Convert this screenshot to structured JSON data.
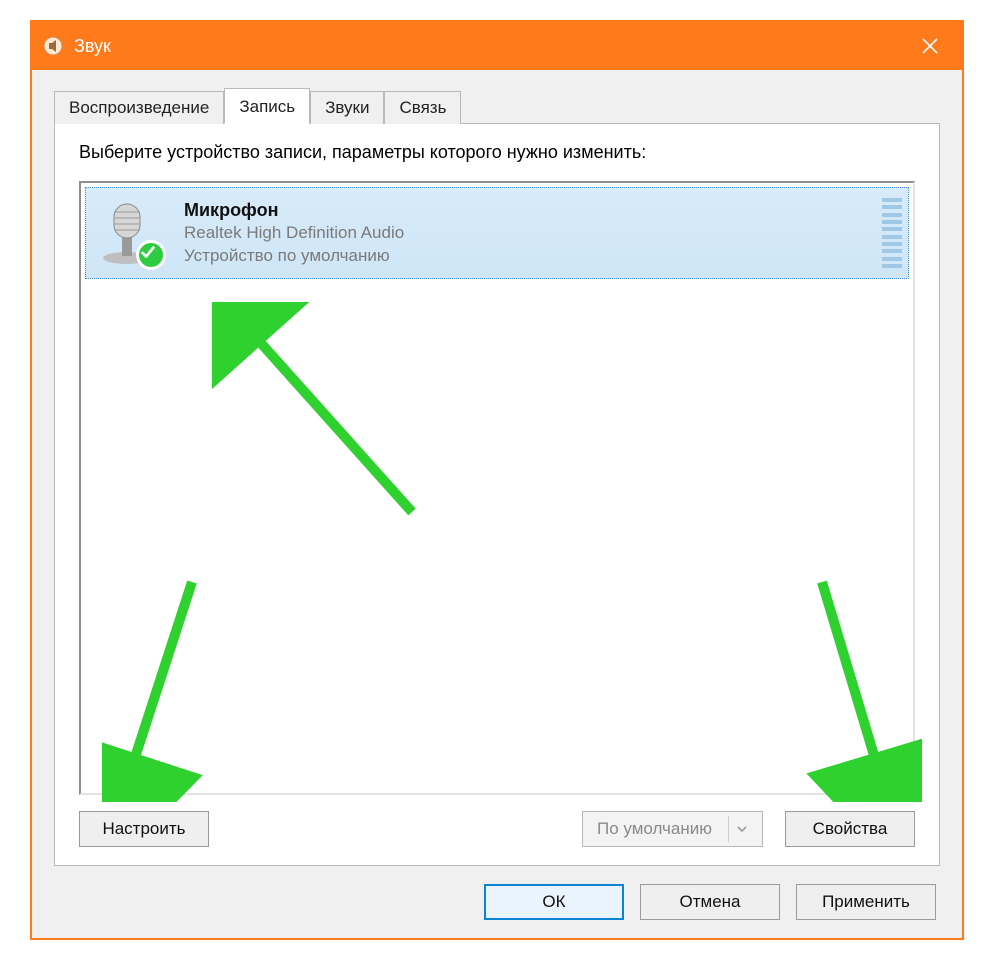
{
  "window": {
    "title": "Звук",
    "close_icon": "close-icon"
  },
  "tabs": {
    "playback": "Воспроизведение",
    "recording": "Запись",
    "sounds": "Звуки",
    "communications": "Связь"
  },
  "recording_tab": {
    "instruction": "Выберите устройство записи, параметры которого нужно изменить:",
    "device": {
      "name": "Микрофон",
      "driver": "Realtek High Definition Audio",
      "status": "Устройство по умолчанию"
    },
    "configure_button": "Настроить",
    "default_dropdown": "По умолчанию",
    "properties_button": "Свойства"
  },
  "dialog_buttons": {
    "ok": "ОК",
    "cancel": "Отмена",
    "apply": "Применить"
  },
  "colors": {
    "accent": "#ff7a1a",
    "annotation_arrow": "#2fd12f"
  }
}
